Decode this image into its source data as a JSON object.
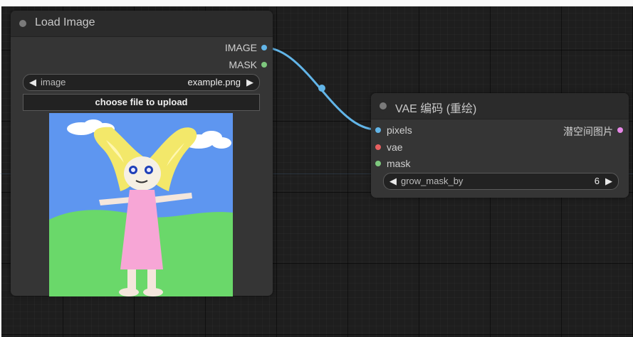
{
  "load_image_node": {
    "title": "Load Image",
    "outputs": [
      {
        "label": "IMAGE",
        "color": "#62b5e8"
      },
      {
        "label": "MASK",
        "color": "#7ec87e"
      }
    ],
    "image_widget": {
      "label": "image",
      "value": "example.png"
    },
    "upload_button": "choose file to upload"
  },
  "vae_node": {
    "title": "VAE 编码 (重绘)",
    "inputs": [
      {
        "label": "pixels",
        "color": "#62b5e8"
      },
      {
        "label": "vae",
        "color": "#e86060"
      },
      {
        "label": "mask",
        "color": "#7ec87e"
      }
    ],
    "output": {
      "label": "潜空间图片",
      "color": "#e888e8"
    },
    "grow_widget": {
      "label": "grow_mask_by",
      "value": "6"
    }
  },
  "icons": [
    "arrow-left-icon",
    "arrow-right-icon"
  ],
  "colors": {
    "wire": "#62b5e8",
    "canvas": "#1e1e1e",
    "node": "#353535"
  }
}
